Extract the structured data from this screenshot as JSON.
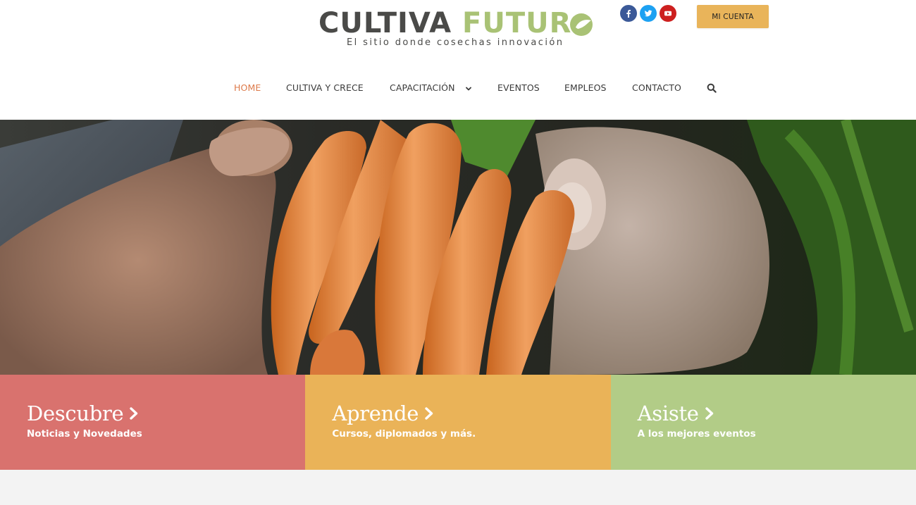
{
  "brand": {
    "name_part1": "CULTIVA",
    "name_part2": "FUTUR",
    "tagline": "El sitio donde cosechas innovación",
    "colors": {
      "dark": "#4a4a48",
      "green": "#a9c275",
      "orange": "#dd7a4a"
    }
  },
  "socials": [
    {
      "icon": "facebook-icon",
      "color": "#3b5998"
    },
    {
      "icon": "twitter-icon",
      "color": "#1da1f2"
    },
    {
      "icon": "youtube-icon",
      "color": "#cd201f"
    }
  ],
  "account_button": {
    "label": "MI CUENTA",
    "color": "#e9b45a"
  },
  "nav": {
    "items": [
      {
        "label": "HOME",
        "active": true
      },
      {
        "label": "CULTIVA Y CRECE",
        "active": false
      },
      {
        "label": "CAPACITACIÓN",
        "active": false,
        "has_dropdown": true
      },
      {
        "label": "EVENTOS",
        "active": false
      },
      {
        "label": "EMPLEOS",
        "active": false
      },
      {
        "label": "CONTACTO",
        "active": false
      }
    ],
    "search_icon": "search-icon"
  },
  "hero": {
    "image": "hands-holding-carrots-photo"
  },
  "tiles": [
    {
      "title": "Descubre",
      "subtitle": "Noticias y Novedades",
      "color": "#d9726e",
      "icon": "chevron-right-icon"
    },
    {
      "title": "Aprende",
      "subtitle": "Cursos, diplomados y más.",
      "color": "#eab358",
      "icon": "chevron-right-icon"
    },
    {
      "title": "Asiste",
      "subtitle": "A los mejores eventos",
      "color": "#b2cc87",
      "icon": "chevron-right-icon"
    }
  ]
}
